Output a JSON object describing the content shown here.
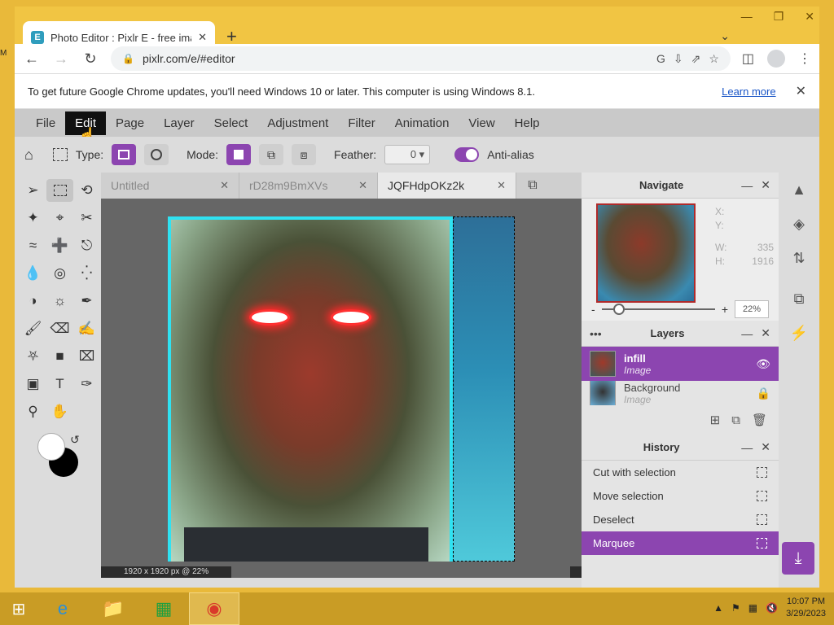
{
  "browser": {
    "tab_title": "Photo Editor : Pixlr E - free image",
    "favicon_letter": "E",
    "url": "pixlr.com/e/#editor",
    "infobar_message": "To get future Google Chrome updates, you'll need Windows 10 or later. This computer is using Windows 8.1.",
    "infobar_link": "Learn more"
  },
  "menu": [
    "File",
    "Edit",
    "Page",
    "Layer",
    "Select",
    "Adjustment",
    "Filter",
    "Animation",
    "View",
    "Help"
  ],
  "options": {
    "type_label": "Type:",
    "mode_label": "Mode:",
    "feather_label": "Feather:",
    "feather_value": "0",
    "antialias_label": "Anti-alias"
  },
  "doc_tabs": [
    "Untitled",
    "rD28m9BmXVs",
    "JQFHdpOKz2k"
  ],
  "status": "1920 x 1920 px @ 22%",
  "navigate": {
    "title": "Navigate",
    "x_label": "X:",
    "y_label": "Y:",
    "w_label": "W:",
    "h_label": "H:",
    "w_value": "335",
    "h_value": "1916",
    "zoom_value": "22%"
  },
  "layers": {
    "title": "Layers",
    "items": [
      {
        "name": "infill",
        "type": "Image"
      },
      {
        "name": "Background",
        "type": "Image"
      }
    ]
  },
  "history": {
    "title": "History",
    "items": [
      "Cut with selection",
      "Move selection",
      "Deselect",
      "Marquee"
    ]
  },
  "clock": {
    "time": "10:07 PM",
    "date": "3/29/2023"
  },
  "colors": {
    "accent": "#8c45b0",
    "selection_border": "#2fe2f2"
  }
}
